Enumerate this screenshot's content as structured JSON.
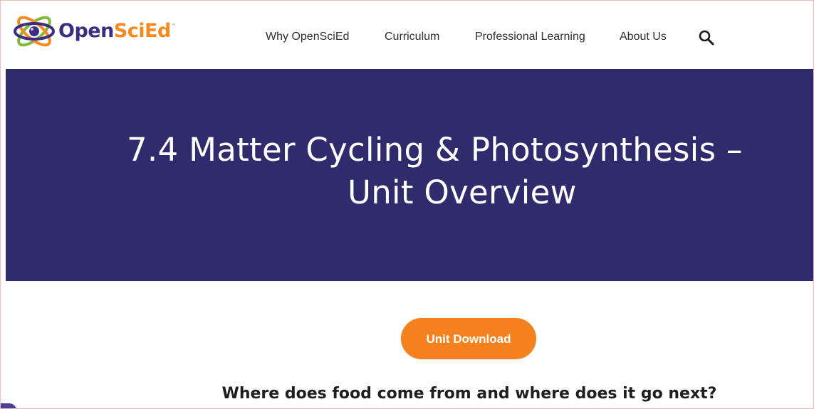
{
  "brand": {
    "name_part1": "Open",
    "name_part2": "SciEd",
    "trademark": "™",
    "colors": {
      "primary": "#3c2d82",
      "accent": "#f68a1f",
      "green": "#7dba3c"
    }
  },
  "nav": {
    "items": [
      {
        "label": "Why OpenSciEd"
      },
      {
        "label": "Curriculum"
      },
      {
        "label": "Professional Learning"
      },
      {
        "label": "About Us"
      }
    ],
    "search_icon": "search-icon"
  },
  "hero": {
    "title_line1": "7.4 Matter Cycling & Photosynthesis –",
    "title_line2": "Unit Overview",
    "background": "#302b6d"
  },
  "main": {
    "download_label": "Unit Download",
    "download_color": "#f5821f",
    "question": "Where does food come from and where does it go next?"
  }
}
